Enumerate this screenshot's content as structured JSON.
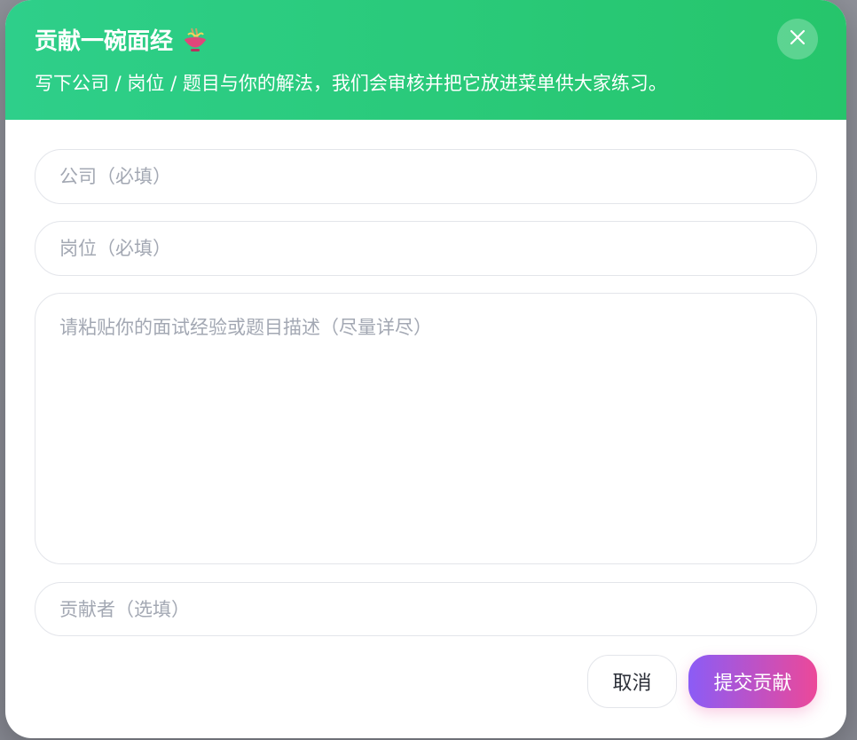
{
  "dialog": {
    "title": "贡献一碗面经",
    "title_icon": "noodle-bowl-icon",
    "subtitle": "写下公司 / 岗位 / 题目与你的解法，我们会审核并把它放进菜单供大家练习。",
    "close_icon": "close-icon"
  },
  "form": {
    "company_placeholder": "公司（必填）",
    "company_value": "",
    "position_placeholder": "岗位（必填）",
    "position_value": "",
    "description_placeholder": "请粘贴你的面试经验或题目描述（尽量详尽）",
    "description_value": "",
    "contributor_placeholder": "贡献者（选填）",
    "contributor_value": ""
  },
  "actions": {
    "cancel_label": "取消",
    "submit_label": "提交贡献"
  },
  "colors": {
    "header_start": "#2ecf8a",
    "header_end": "#26c56b",
    "submit_start": "#8b5cf6",
    "submit_end": "#ec4899"
  }
}
